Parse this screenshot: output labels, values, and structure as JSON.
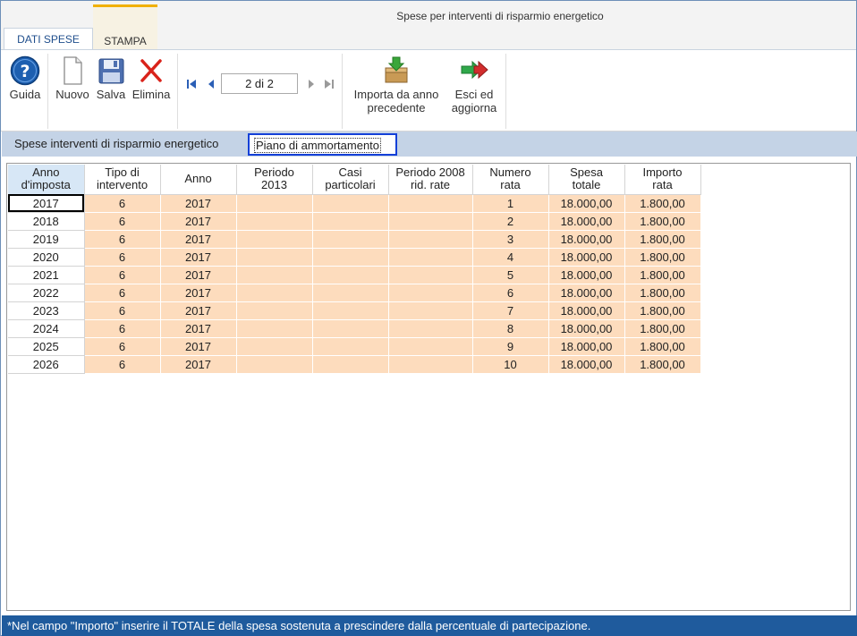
{
  "window": {
    "title": "Spese per interventi di risparmio energetico"
  },
  "tabs": {
    "dati_spese": "DATI SPESE",
    "stampa": "STAMPA"
  },
  "ribbon": {
    "guida": "Guida",
    "nuovo": "Nuovo",
    "salva": "Salva",
    "elimina": "Elimina",
    "pager": "2 di 2",
    "importa_line1": "Importa da anno",
    "importa_line2": "precedente",
    "esci_line1": "Esci ed",
    "esci_line2": "aggiorna"
  },
  "section": {
    "label": "Spese interventi di risparmio energetico",
    "active_tab": "Piano di ammortamento"
  },
  "table": {
    "headers": [
      [
        "Anno",
        "d'imposta"
      ],
      [
        "Tipo di",
        "intervento"
      ],
      [
        "Anno",
        ""
      ],
      [
        "Periodo",
        "2013"
      ],
      [
        "Casi",
        "particolari"
      ],
      [
        "Periodo 2008",
        "rid. rate"
      ],
      [
        "Numero",
        "rata"
      ],
      [
        "Spesa",
        "totale"
      ],
      [
        "Importo",
        "rata"
      ]
    ],
    "rows": [
      [
        "2017",
        "6",
        "2017",
        "",
        "",
        "",
        "1",
        "18.000,00",
        "1.800,00"
      ],
      [
        "2018",
        "6",
        "2017",
        "",
        "",
        "",
        "2",
        "18.000,00",
        "1.800,00"
      ],
      [
        "2019",
        "6",
        "2017",
        "",
        "",
        "",
        "3",
        "18.000,00",
        "1.800,00"
      ],
      [
        "2020",
        "6",
        "2017",
        "",
        "",
        "",
        "4",
        "18.000,00",
        "1.800,00"
      ],
      [
        "2021",
        "6",
        "2017",
        "",
        "",
        "",
        "5",
        "18.000,00",
        "1.800,00"
      ],
      [
        "2022",
        "6",
        "2017",
        "",
        "",
        "",
        "6",
        "18.000,00",
        "1.800,00"
      ],
      [
        "2023",
        "6",
        "2017",
        "",
        "",
        "",
        "7",
        "18.000,00",
        "1.800,00"
      ],
      [
        "2024",
        "6",
        "2017",
        "",
        "",
        "",
        "8",
        "18.000,00",
        "1.800,00"
      ],
      [
        "2025",
        "6",
        "2017",
        "",
        "",
        "",
        "9",
        "18.000,00",
        "1.800,00"
      ],
      [
        "2026",
        "6",
        "2017",
        "",
        "",
        "",
        "10",
        "18.000,00",
        "1.800,00"
      ]
    ]
  },
  "footer": {
    "note": "*Nel campo \"Importo\" inserire il TOTALE della spesa sostenuta a prescindere dalla percentuale di partecipazione."
  },
  "colors": {
    "accent": "#1f5b9d",
    "cell_fill": "#fddcbd",
    "section_bar": "#c4d3e6",
    "stampa_tab_border": "#f0b000"
  },
  "icons": {
    "guida": "help-icon",
    "nuovo": "new-document-icon",
    "salva": "floppy-disk-icon",
    "elimina": "delete-x-icon",
    "importa": "import-box-icon",
    "esci": "exit-arrow-icon"
  }
}
